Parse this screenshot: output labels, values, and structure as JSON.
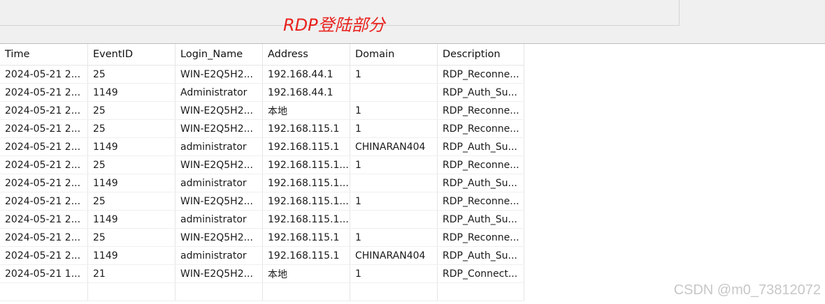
{
  "overlay_title": "RDP登陆部分",
  "watermark": "CSDN @m0_73812072",
  "table": {
    "headers": [
      "Time",
      "EventID",
      "Login_Name",
      "Address",
      "Domain",
      "Description"
    ],
    "rows": [
      [
        "2024-05-21 2...",
        "25",
        "WIN-E2Q5H2...",
        "192.168.44.1",
        "1",
        "RDP_Reconne..."
      ],
      [
        "2024-05-21 2...",
        "1149",
        "Administrator",
        "192.168.44.1",
        "",
        "RDP_Auth_Su..."
      ],
      [
        "2024-05-21 2...",
        "25",
        "WIN-E2Q5H2...",
        "本地",
        "1",
        "RDP_Reconne..."
      ],
      [
        "2024-05-21 2...",
        "25",
        "WIN-E2Q5H2...",
        "192.168.115.1",
        "1",
        "RDP_Reconne..."
      ],
      [
        "2024-05-21 2...",
        "1149",
        "administrator",
        "192.168.115.1",
        "CHINARAN404",
        "RDP_Auth_Su..."
      ],
      [
        "2024-05-21 2...",
        "25",
        "WIN-E2Q5H2...",
        "192.168.115.1...",
        "1",
        "RDP_Reconne..."
      ],
      [
        "2024-05-21 2...",
        "1149",
        "administrator",
        "192.168.115.1...",
        "",
        "RDP_Auth_Su..."
      ],
      [
        "2024-05-21 2...",
        "25",
        "WIN-E2Q5H2...",
        "192.168.115.1...",
        "1",
        "RDP_Reconne..."
      ],
      [
        "2024-05-21 2...",
        "1149",
        "administrator",
        "192.168.115.1...",
        "",
        "RDP_Auth_Su..."
      ],
      [
        "2024-05-21 2...",
        "25",
        "WIN-E2Q5H2...",
        "192.168.115.1",
        "1",
        "RDP_Reconne..."
      ],
      [
        "2024-05-21 2...",
        "1149",
        "administrator",
        "192.168.115.1",
        "CHINARAN404",
        "RDP_Auth_Su..."
      ],
      [
        "2024-05-21 1...",
        "21",
        "WIN-E2Q5H2...",
        "本地",
        "1",
        "RDP_Connect..."
      ],
      [
        "",
        "",
        "",
        "",
        "",
        ""
      ]
    ]
  }
}
